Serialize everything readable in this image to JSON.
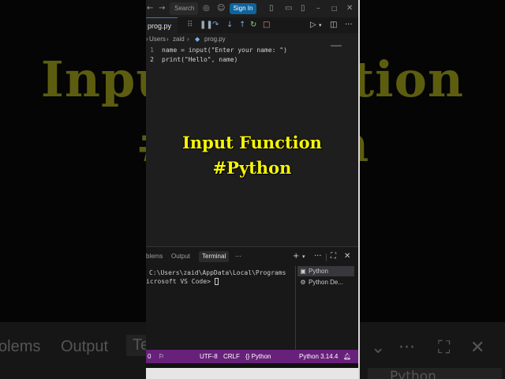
{
  "background": {
    "big_title": "Input Function",
    "big_tag": "#Python",
    "tabs": {
      "problems": "olems",
      "output": "Output",
      "terminal": "Te"
    },
    "python_item": "Python"
  },
  "titlebar": {
    "search_placeholder": "Search",
    "sign_in": "Sign In"
  },
  "editor": {
    "tab_label": "prog.py",
    "breadcrumb": {
      "users": "Users",
      "zaid": "zaid",
      "file": "prog.py"
    },
    "lines": [
      {
        "number": "1",
        "text": "name = input(\"Enter your name: \")"
      },
      {
        "number": "2",
        "text": "print(\"Hello\", name)"
      }
    ]
  },
  "overlay": {
    "title": "Input Function",
    "tag": "#Python"
  },
  "panel": {
    "tabs": {
      "problems": "blems",
      "output": "Output",
      "terminal": "Terminal"
    },
    "terminal_lines": [
      "C:\\Users\\zaid\\AppData\\Local\\Programs",
      "icrosoft VS Code> "
    ],
    "terminal_list": [
      {
        "label": "Python",
        "icon": "terminal-icon"
      },
      {
        "label": "Python De...",
        "icon": "debug-icon"
      }
    ]
  },
  "statusbar": {
    "errors": "0",
    "encoding": "UTF-8",
    "eol": "CRLF",
    "language": "Python",
    "interpreter": "Python 3.14.4"
  },
  "colors": {
    "statusbar_bg": "#68217a",
    "overlay_text": "#f5f506",
    "sign_in_bg": "#0e639c",
    "terminal_tab_active": "#2b2b2b"
  }
}
